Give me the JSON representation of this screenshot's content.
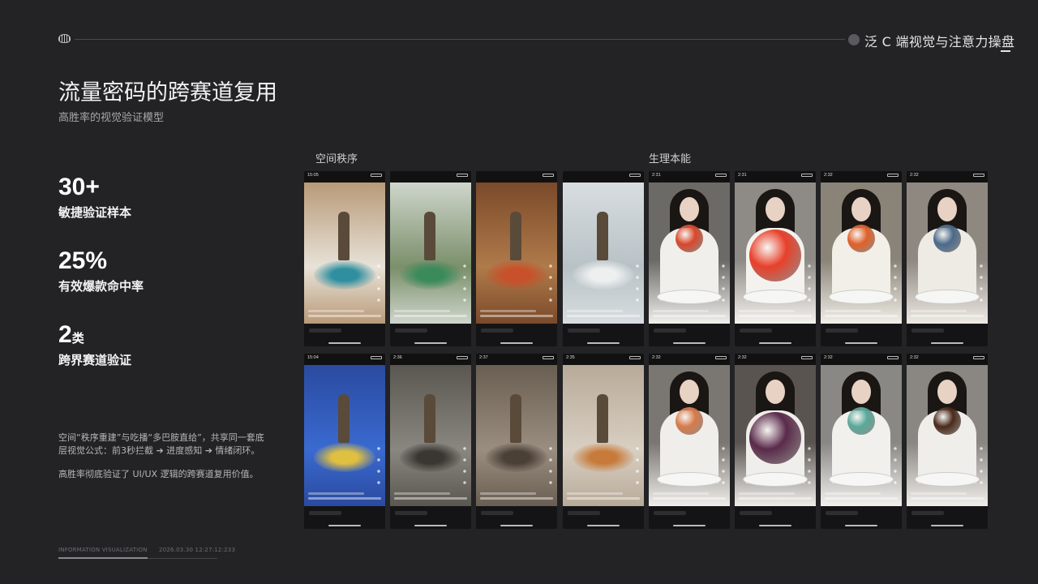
{
  "header": {
    "title": "泛 C 端视觉与注意力操盘"
  },
  "page": {
    "title": "流量密码的跨赛道复用",
    "subtitle": "高胜率的视觉验证模型"
  },
  "stats": [
    {
      "value": "30+",
      "unit": "",
      "label": "敏捷验证样本"
    },
    {
      "value": "25%",
      "unit": "",
      "label": "有效爆款命中率"
    },
    {
      "value": "2",
      "unit": "类",
      "label": "跨界赛道验证"
    }
  ],
  "description": {
    "p1": "空间“秩序重建”与吃播“多巴胺直给”，共享同一套底层视觉公式：前3秒拦截 ➔ 进度感知 ➔ 情绪闭环。",
    "p2": "高胜率彻底验证了 UI/UX 逻辑的跨赛道复用价值。"
  },
  "footer": {
    "label": "INFORMATION VISUALIZATION",
    "timestamp": "2026.03.30 12:27:12:233"
  },
  "sections": {
    "left": "空间秩序",
    "right": "生理本能"
  },
  "cards": [
    {
      "time": "15:05",
      "scene": "worker-pouring-blue-paint",
      "colors": [
        "#b89a78",
        "#e8e2d8",
        "#2f8fa0"
      ]
    },
    {
      "time": "",
      "scene": "worker-green-tub",
      "colors": [
        "#cfd6cc",
        "#7a8f6a",
        "#3a8a5a"
      ]
    },
    {
      "time": "",
      "scene": "woman-pouring-beads",
      "colors": [
        "#7a4a2a",
        "#b07a4a",
        "#c8502a"
      ]
    },
    {
      "time": "",
      "scene": "foam-filled-room",
      "colors": [
        "#d8dde0",
        "#b8c2c6",
        "#eef0f0"
      ]
    },
    {
      "time": "2:31",
      "scene": "girl-eating-red-fruit",
      "colors": [
        "#6c6a66",
        "#f0efeb",
        "#d8472a"
      ]
    },
    {
      "time": "2:31",
      "scene": "girl-with-red-jelly",
      "colors": [
        "#8e8a86",
        "#f4f2ee",
        "#e8402a"
      ]
    },
    {
      "time": "2:32",
      "scene": "girl-holding-orange",
      "colors": [
        "#8a8478",
        "#f2efe8",
        "#e0602a"
      ]
    },
    {
      "time": "2:32",
      "scene": "girl-holding-blue-fruit",
      "colors": [
        "#8e8880",
        "#eeeae4",
        "#4a6a8a"
      ]
    },
    {
      "time": "15:04",
      "scene": "blue-paint-pool",
      "colors": [
        "#2a4aa0",
        "#3a6ad0",
        "#e0c040"
      ]
    },
    {
      "time": "2:36",
      "scene": "collapsed-cave",
      "colors": [
        "#5a5650",
        "#8a8680",
        "#3a3632"
      ]
    },
    {
      "time": "2:37",
      "scene": "workers-demolition",
      "colors": [
        "#6a5e52",
        "#9a8e80",
        "#4a4036"
      ]
    },
    {
      "time": "2:35",
      "scene": "woman-with-dogs",
      "colors": [
        "#b8aa98",
        "#d8cfc2",
        "#c87a3a"
      ]
    },
    {
      "time": "2:32",
      "scene": "girl-eating-crab",
      "colors": [
        "#7a7672",
        "#f0eeea",
        "#d87a4a"
      ]
    },
    {
      "time": "2:32",
      "scene": "girl-with-purple-ball",
      "colors": [
        "#5a5450",
        "#f0eeea",
        "#5a2a4a"
      ]
    },
    {
      "time": "2:32",
      "scene": "girl-with-teal-dish",
      "colors": [
        "#8a8884",
        "#f2f0ec",
        "#5aa89a"
      ]
    },
    {
      "time": "2:32",
      "scene": "girl-with-chocolate-sphere",
      "colors": [
        "#8a8682",
        "#f0eeea",
        "#4a2a1a"
      ]
    }
  ]
}
